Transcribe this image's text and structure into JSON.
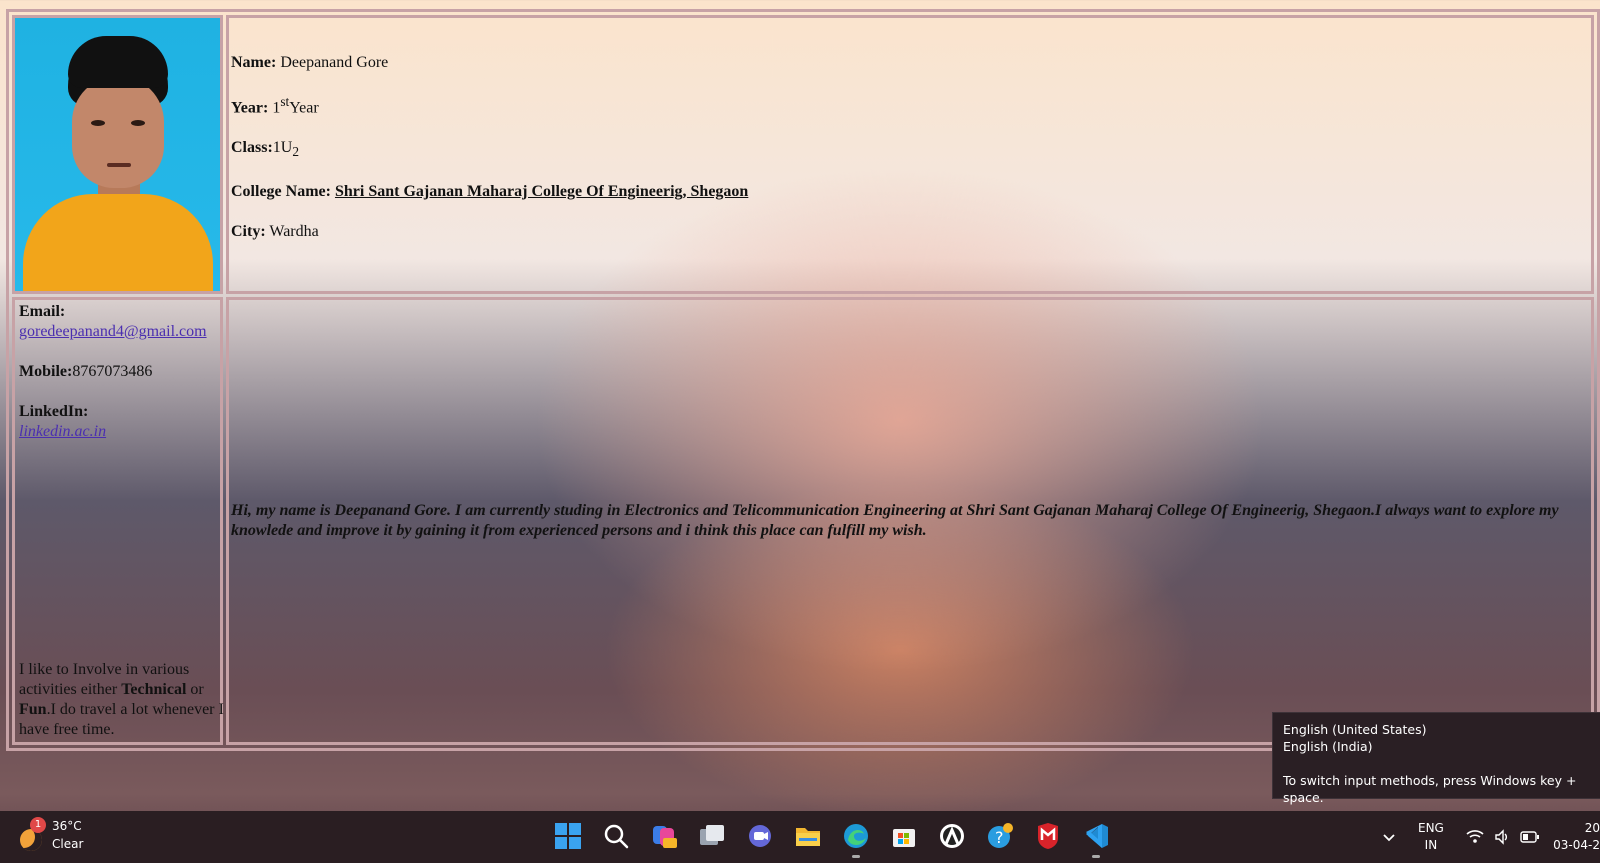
{
  "profile": {
    "name_label": "Name:",
    "name": "Deepanand Gore",
    "year_label": "Year:",
    "year_num": "1",
    "year_sup": "st",
    "year_word": "Year",
    "class_label": "Class:",
    "class_main": "1U",
    "class_sub": "2",
    "college_label": "College Name:",
    "college": "Shri Sant Gajanan Maharaj College Of Engineerig, Shegaon",
    "city_label": "City:",
    "city": "Wardha"
  },
  "contact": {
    "email_label": "Email:",
    "email": "goredeepanand4@gmail.com",
    "mobile_label": "Mobile:",
    "mobile": "8767073486",
    "linkedin_label": "LinkedIn:",
    "linkedin": "linkedin.ac.in"
  },
  "hobby": {
    "prefix": "I like to Involve in various activities either ",
    "technical": "Technical",
    "or": " or ",
    "fun": "Fun",
    "suffix": ".I do travel a lot whenever I have free time."
  },
  "about": "Hi, my name is Deepanand Gore. I am currently studing in Electronics and Telicommunication Engineering at Shri Sant Gajanan Maharaj College Of Engineerig, Shegaon.I always want to explore my knowlede and improve it by gaining it from experienced persons and i think this place can fulfill my wish.",
  "input_tooltip": {
    "option1": "English (United States)",
    "option2": "English (India)",
    "hint": "To switch input methods, press Windows key + space."
  },
  "taskbar": {
    "weather_badge": "1",
    "temperature": "36°C",
    "condition": "Clear",
    "lang_top": "ENG",
    "lang_bottom": "IN",
    "time": "20",
    "date": "03-04-2",
    "icons": [
      "windows-start",
      "search",
      "copilot",
      "task-view",
      "teams-chat",
      "file-explorer",
      "edge",
      "microsoft-store",
      "app",
      "get-help",
      "mcafee",
      "vs-code"
    ]
  }
}
